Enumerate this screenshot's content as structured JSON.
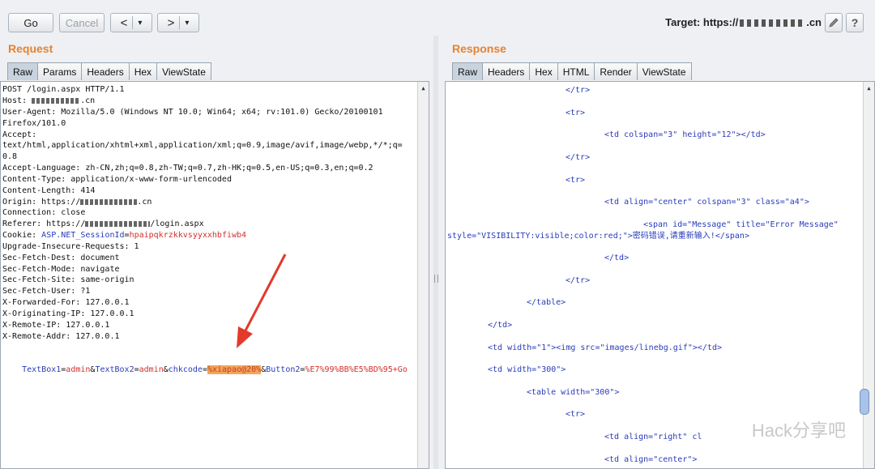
{
  "toolbar": {
    "go_label": "Go",
    "cancel_label": "Cancel",
    "back_label": "<",
    "forward_label": ">",
    "dropdown_glyph": "▾",
    "target_prefix": "Target: https://",
    "target_suffix": ".cn",
    "edit_icon": "pencil-icon",
    "help_label": "?"
  },
  "request": {
    "title": "Request",
    "tabs": [
      "Raw",
      "Params",
      "Headers",
      "Hex",
      "ViewState"
    ],
    "active_tab": "Raw",
    "lines": {
      "l1": "POST /login.aspx HTTP/1.1",
      "l2a": "Host: ",
      "l2b": ".cn",
      "l3": "User-Agent: Mozilla/5.0 (Windows NT 10.0; Win64; x64; rv:101.0) Gecko/20100101",
      "l4": "Firefox/101.0",
      "l5": "Accept:",
      "l6": "text/html,application/xhtml+xml,application/xml;q=0.9,image/avif,image/webp,*/*;q=",
      "l7": "0.8",
      "l8": "Accept-Language: zh-CN,zh;q=0.8,zh-TW;q=0.7,zh-HK;q=0.5,en-US;q=0.3,en;q=0.2",
      "l9": "Content-Type: application/x-www-form-urlencoded",
      "l10": "Content-Length: 414",
      "l11a": "Origin: https://",
      "l11b": ".cn",
      "l12": "Connection: close",
      "l13a": "Referer: https://",
      "l13b": "/login.aspx",
      "l14a": "Cookie: ",
      "l14b": "ASP.NET_SessionId",
      "l14c": "=",
      "l14d": "hpaipqkrzkkvsyyxxhbfiwb4",
      "l15": "Upgrade-Insecure-Requests: 1",
      "l16": "Sec-Fetch-Dest: document",
      "l17": "Sec-Fetch-Mode: navigate",
      "l18": "Sec-Fetch-Site: same-origin",
      "l19": "Sec-Fetch-User: ?1",
      "l20": "X-Forwarded-For: 127.0.0.1",
      "l21": "X-Originating-IP: 127.0.0.1",
      "l22": "X-Remote-IP: 127.0.0.1",
      "l23": "X-Remote-Addr: 127.0.0.1",
      "body_k1": "TextBox1",
      "body_v1": "admin",
      "body_k2": "TextBox2",
      "body_v2": "admin",
      "body_k3": "chkcode",
      "body_v3": "%xiapao@20%",
      "body_k4": "Button2",
      "body_v4": "%E7%99%BB%E5%BD%95+Go"
    }
  },
  "response": {
    "title": "Response",
    "tabs": [
      "Raw",
      "Headers",
      "Hex",
      "HTML",
      "Render",
      "ViewState"
    ],
    "active_tab": "Raw",
    "lines": {
      "r1": "</tr>",
      "r2": "<tr>",
      "r3": "<td colspan=\"3\" height=\"12\"></td>",
      "r4": "</tr>",
      "r5": "<tr>",
      "r6": "<td align=\"center\" colspan=\"3\" class=\"a4\">",
      "r7": "<span id=\"Message\" title=\"Error Message\"",
      "r8": "style=\"VISIBILITY:visible;color:red;\">密码错误,请重新输入!</span>",
      "r9": "</td>",
      "r10": "</tr>",
      "r11": "</table>",
      "r12": "</td>",
      "r13": "<td width=\"1\"><img src=\"images/linebg.gif\"></td>",
      "r14": "<td width=\"300\">",
      "r15": "<table width=\"300\">",
      "r16": "<tr>",
      "r17": "<td align=\"right\" cl",
      "r18": "<td align=\"center\">"
    }
  },
  "watermark": "Hack分享吧"
}
